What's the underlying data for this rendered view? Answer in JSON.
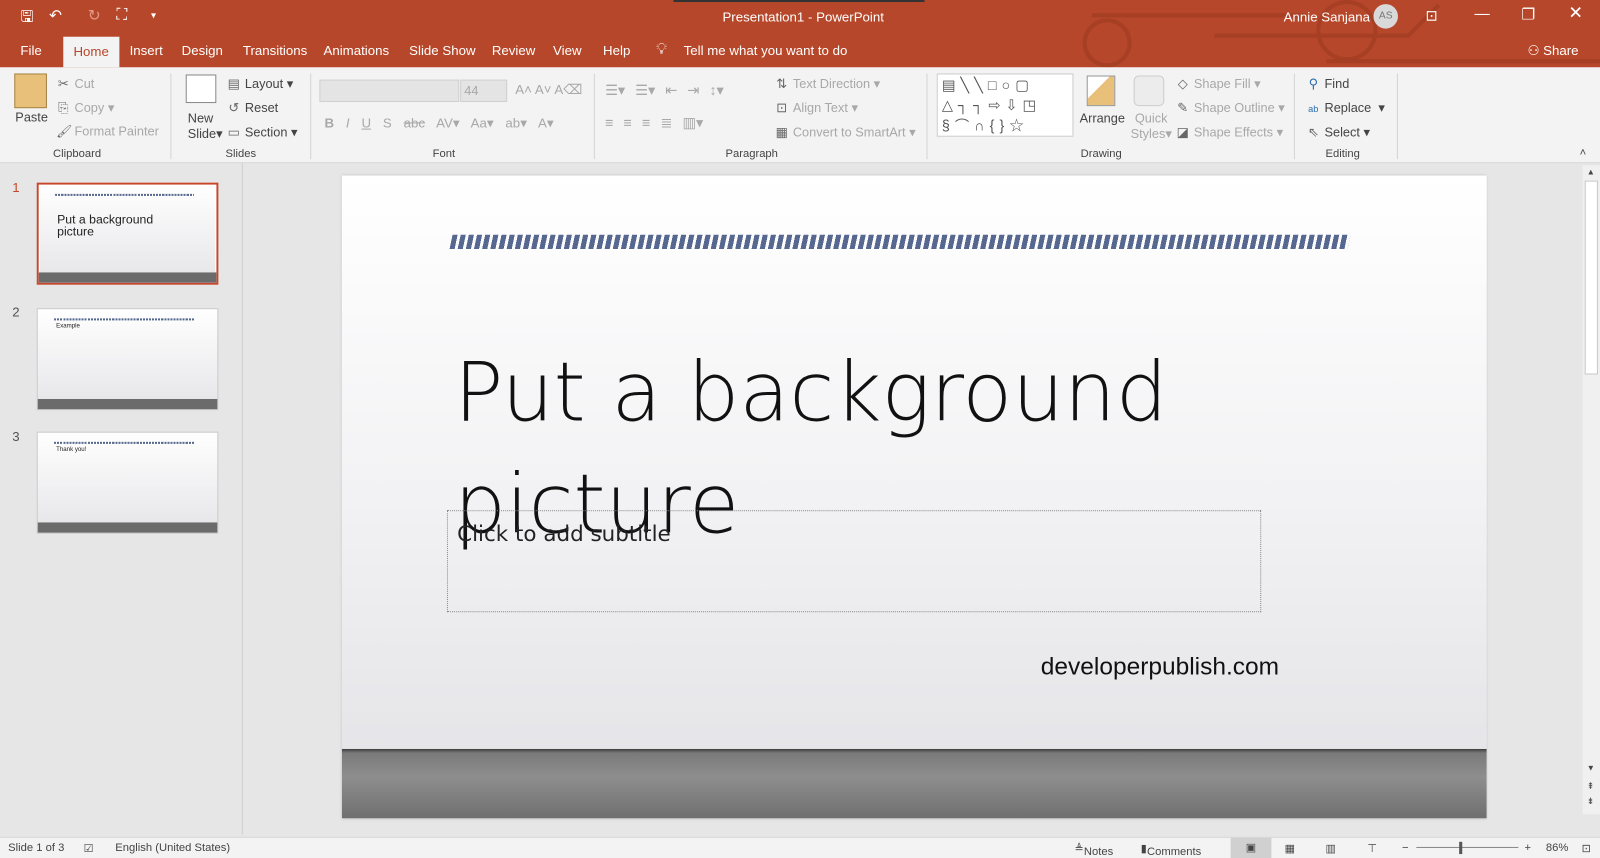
{
  "window": {
    "title": "Presentation1  -  PowerPoint",
    "user": "Annie Sanjana",
    "avatar": "AS",
    "share": "Share",
    "accent": "#b7472a"
  },
  "qat": {
    "save": "save-icon",
    "undo": "undo-icon",
    "redo": "redo-icon",
    "present": "start-from-beginning-icon"
  },
  "tabs": [
    "File",
    "Home",
    "Insert",
    "Design",
    "Transitions",
    "Animations",
    "Slide Show",
    "Review",
    "View",
    "Help"
  ],
  "tell_me": "Tell me what you want to do",
  "ribbon": {
    "clipboard": {
      "label": "Clipboard",
      "paste": "Paste",
      "cut": "Cut",
      "copy": "Copy",
      "format_painter": "Format Painter"
    },
    "slides": {
      "label": "Slides",
      "new_slide": "New",
      "new_slide2": "Slide",
      "layout": "Layout",
      "reset": "Reset",
      "section": "Section"
    },
    "font": {
      "label": "Font",
      "font_name": "",
      "font_size": "44"
    },
    "paragraph": {
      "label": "Paragraph",
      "text_direction": "Text Direction",
      "align_text": "Align Text",
      "convert": "Convert to SmartArt"
    },
    "drawing": {
      "label": "Drawing",
      "arrange": "Arrange",
      "quick": "Quick",
      "styles": "Styles",
      "shape_fill": "Shape Fill",
      "shape_outline": "Shape Outline",
      "shape_effects": "Shape Effects"
    },
    "editing": {
      "label": "Editing",
      "find": "Find",
      "replace": "Replace",
      "select": "Select"
    }
  },
  "thumbnails": [
    {
      "num": "1",
      "text": "Put a background picture"
    },
    {
      "num": "2",
      "text": "Example"
    },
    {
      "num": "3",
      "text": "Thank you!"
    }
  ],
  "slide": {
    "title": "Put a background picture",
    "subtitle_placeholder": "Click to add subtitle",
    "footer_text": "developerpublish.com"
  },
  "status": {
    "slide": "Slide 1 of 3",
    "language": "English (United States)",
    "notes": "Notes",
    "comments": "Comments",
    "zoom": "86%"
  }
}
